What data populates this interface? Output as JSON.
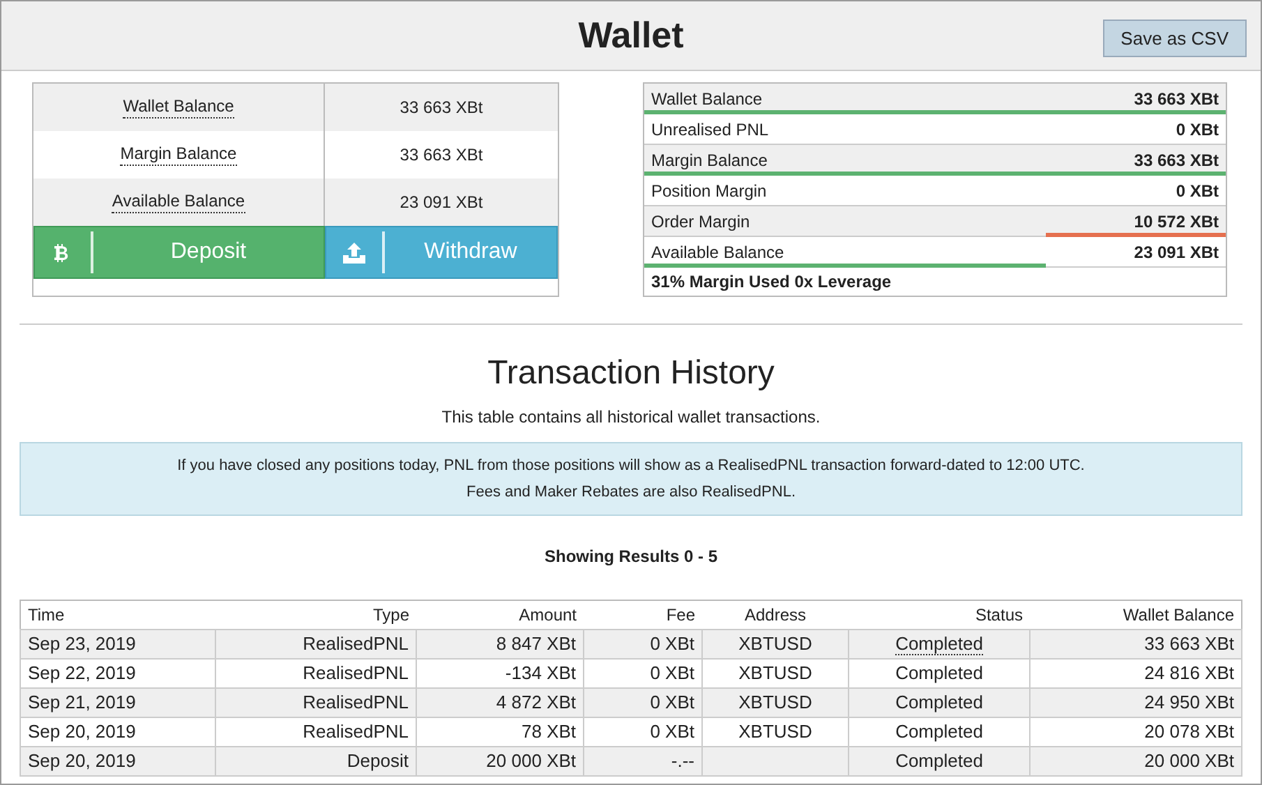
{
  "window": {
    "title": "Wallet"
  },
  "toolbar": {
    "save_button": "Save as CSV"
  },
  "balances": [
    {
      "label": "Wallet Balance",
      "value": "33 663 XBt"
    },
    {
      "label": "Margin Balance",
      "value": "33 663 XBt"
    },
    {
      "label": "Available Balance",
      "value": "23 091 XBt"
    }
  ],
  "actions": [
    {
      "label": "Deposit",
      "kind": "deposit"
    },
    {
      "label": "Withdraw",
      "kind": "withdraw"
    }
  ],
  "summary": {
    "rows": [
      {
        "label": "Wallet Balance",
        "value": "33 663 XBt",
        "kind": "fill_left",
        "level": 1,
        "color": "#5cb270"
      },
      {
        "label": "Unrealised PNL",
        "value": "0 XBt",
        "kind": "plain"
      },
      {
        "label": "Margin Balance",
        "value": "33 663 XBt",
        "kind": "fill_left",
        "level": 1,
        "color": "#5cb270"
      },
      {
        "label": "Position Margin",
        "value": "0 XBt",
        "kind": "plain"
      },
      {
        "label": "Order Margin",
        "value": "10 572 XBt",
        "kind": "fill_right",
        "level": 0.31,
        "color": "#e5704f"
      },
      {
        "label": "Available Balance",
        "value": "23 091 XBt",
        "kind": "fill_left",
        "level": 0.69,
        "color": "#5cb270"
      }
    ],
    "footer": "31% Margin Used 0x Leverage"
  },
  "history": {
    "title": "Transaction History",
    "subtitle": "This table contains all historical wallet transactions.",
    "notice": [
      "If you have closed any positions today, PNL from those positions will show as a RealisedPNL transaction forward-dated to 12:00 UTC.",
      "Fees and Maker Rebates are also RealisedPNL."
    ],
    "results": "Showing Results 0 - 5",
    "table": {
      "columns": [
        "Time",
        "Type",
        "Amount",
        "Fee",
        "Address",
        "Status",
        "Wallet Balance"
      ],
      "rows": [
        {
          "cells": [
            "Sep 23, 2019",
            "RealisedPNL",
            "8 847 XBt",
            "0 XBt",
            "XBTUSD",
            "Completed",
            "33 663 XBt"
          ],
          "status_hint": true
        },
        {
          "cells": [
            "Sep 22, 2019",
            "RealisedPNL",
            "-134 XBt",
            "0 XBt",
            "XBTUSD",
            "Completed",
            "24 816 XBt"
          ],
          "status_hint": false
        },
        {
          "cells": [
            "Sep 21, 2019",
            "RealisedPNL",
            "4 872 XBt",
            "0 XBt",
            "XBTUSD",
            "Completed",
            "24 950 XBt"
          ],
          "status_hint": false
        },
        {
          "cells": [
            "Sep 20, 2019",
            "RealisedPNL",
            "78 XBt",
            "0 XBt",
            "XBTUSD",
            "Completed",
            "20 078 XBt"
          ],
          "status_hint": false
        },
        {
          "cells": [
            "Sep 20, 2019",
            "Deposit",
            "20 000 XBt",
            "-.--",
            "",
            "Completed",
            "20 000 XBt"
          ],
          "status_hint": false
        }
      ]
    }
  }
}
